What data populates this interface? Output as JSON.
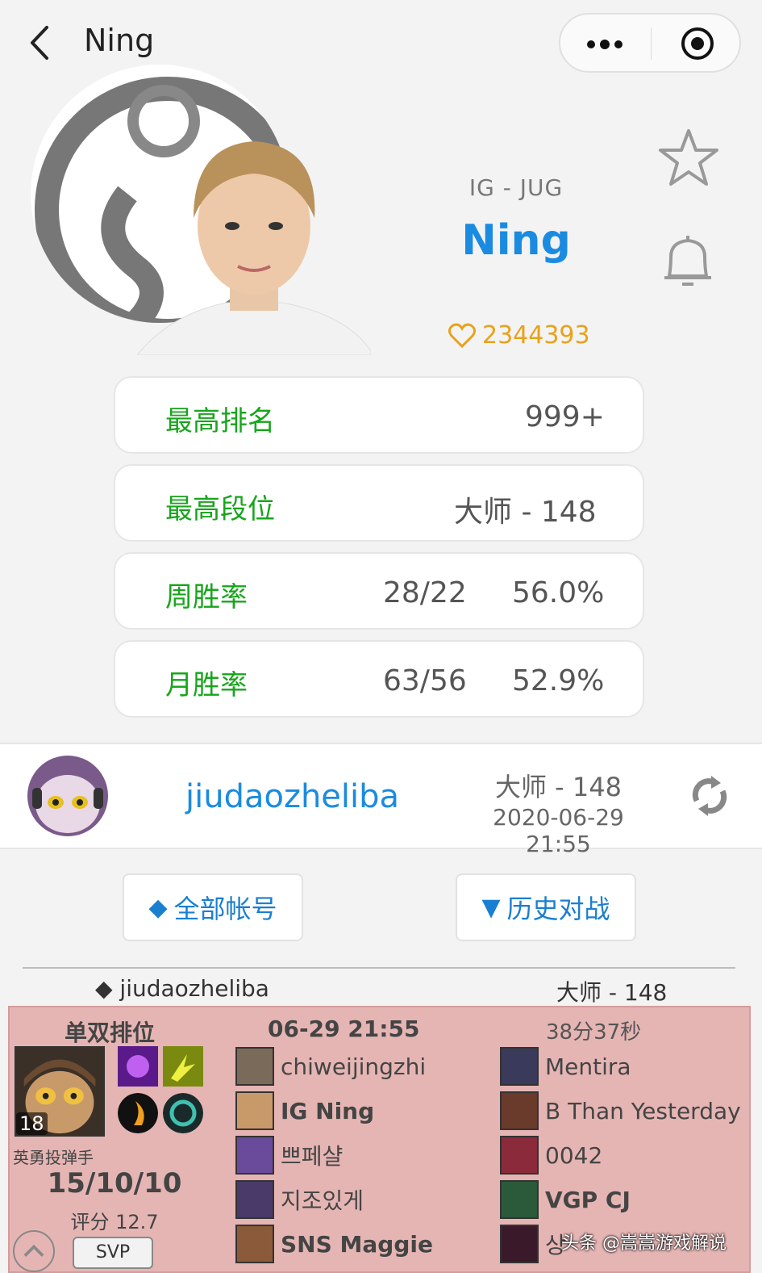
{
  "header": {
    "title": "Ning"
  },
  "profile": {
    "team_position": "IG - JUG",
    "name": "Ning",
    "likes": "2344393"
  },
  "stats": [
    {
      "label": "最高排名",
      "value1": "999+",
      "value2": ""
    },
    {
      "label": "最高段位",
      "value1": "大师 - 148",
      "value2": ""
    },
    {
      "label": "周胜率",
      "value1": "28/22",
      "value2": "56.0%"
    },
    {
      "label": "月胜率",
      "value1": "63/56",
      "value2": "52.9%"
    }
  ],
  "account": {
    "name": "jiudaozheliba",
    "rank": "大师 - 148",
    "updated": "2020-06-29 21:55"
  },
  "buttons": {
    "all_accounts": "全部帐号",
    "history": "历史对战"
  },
  "history": {
    "account_label": "◆ jiudaozheliba",
    "rank": "大师 - 148",
    "match": {
      "mode": "单双排位",
      "date": "06-29 21:55",
      "duration": "38分37秒",
      "level": "18",
      "champion": "英勇投弹手",
      "kda": "15/10/10",
      "score": "评分 12.7",
      "badge": "SVP",
      "team_blue": [
        {
          "name": "chiweijingzhi",
          "bold": false
        },
        {
          "name": "IG Ning",
          "bold": true
        },
        {
          "name": "쁘페샬",
          "bold": false
        },
        {
          "name": "지조있게",
          "bold": false
        },
        {
          "name": "SNS Maggie",
          "bold": true
        }
      ],
      "team_red": [
        {
          "name": "Mentira",
          "bold": false
        },
        {
          "name": "B Than Yesterday",
          "bold": false
        },
        {
          "name": "0042",
          "bold": false
        },
        {
          "name": "VGP CJ",
          "bold": true
        },
        {
          "name": "상",
          "bold": false
        }
      ]
    }
  },
  "watermark": "头条 @嵩嵩游戏解说",
  "colors": {
    "accent": "#1a8be0",
    "green": "#18a51c",
    "gold": "#e8a21a",
    "loss_bg": "#e5b5b4"
  }
}
